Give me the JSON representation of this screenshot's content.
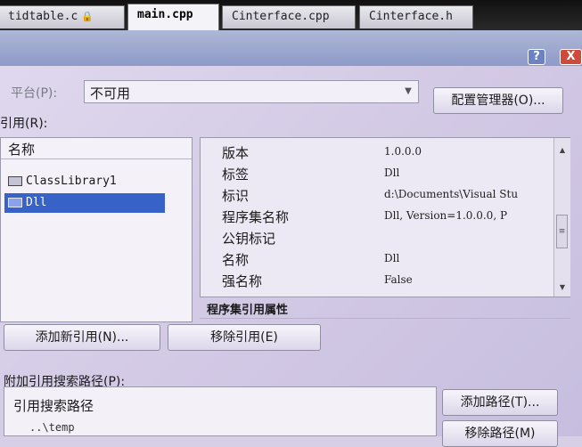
{
  "tabs": [
    {
      "label": "tidtable.c",
      "lock": "🔒"
    },
    {
      "label": "main.cpp"
    },
    {
      "label": "Cinterface.cpp"
    },
    {
      "label": "Cinterface.h"
    }
  ],
  "window": {
    "help": "?",
    "close": "X"
  },
  "platform": {
    "label": "平台(P):",
    "value": "不可用"
  },
  "config_button": "配置管理器(O)...",
  "references": {
    "label": "引用(R):",
    "column_header": "名称",
    "items": [
      "ClassLibrary1",
      "Dll"
    ]
  },
  "properties": [
    {
      "name": "版本",
      "value": "1.0.0.0"
    },
    {
      "name": "标签",
      "value": "Dll"
    },
    {
      "name": "标识",
      "value": "d:\\Documents\\Visual Stu"
    },
    {
      "name": "程序集名称",
      "value": "Dll, Version=1.0.0.0, P"
    },
    {
      "name": "公钥标记",
      "value": ""
    },
    {
      "name": "名称",
      "value": "Dll"
    },
    {
      "name": "强名称",
      "value": "False"
    }
  ],
  "properties_desc": "程序集引用属性",
  "buttons": {
    "add_reference": "添加新引用(N)...",
    "remove_reference": "移除引用(E)",
    "add_path": "添加路径(T)...",
    "remove_path": "移除路径(M)"
  },
  "search_paths": {
    "label": "附加引用搜索路径(P):",
    "column_header": "引用搜索路径",
    "entries": [
      "..\\temp"
    ]
  }
}
